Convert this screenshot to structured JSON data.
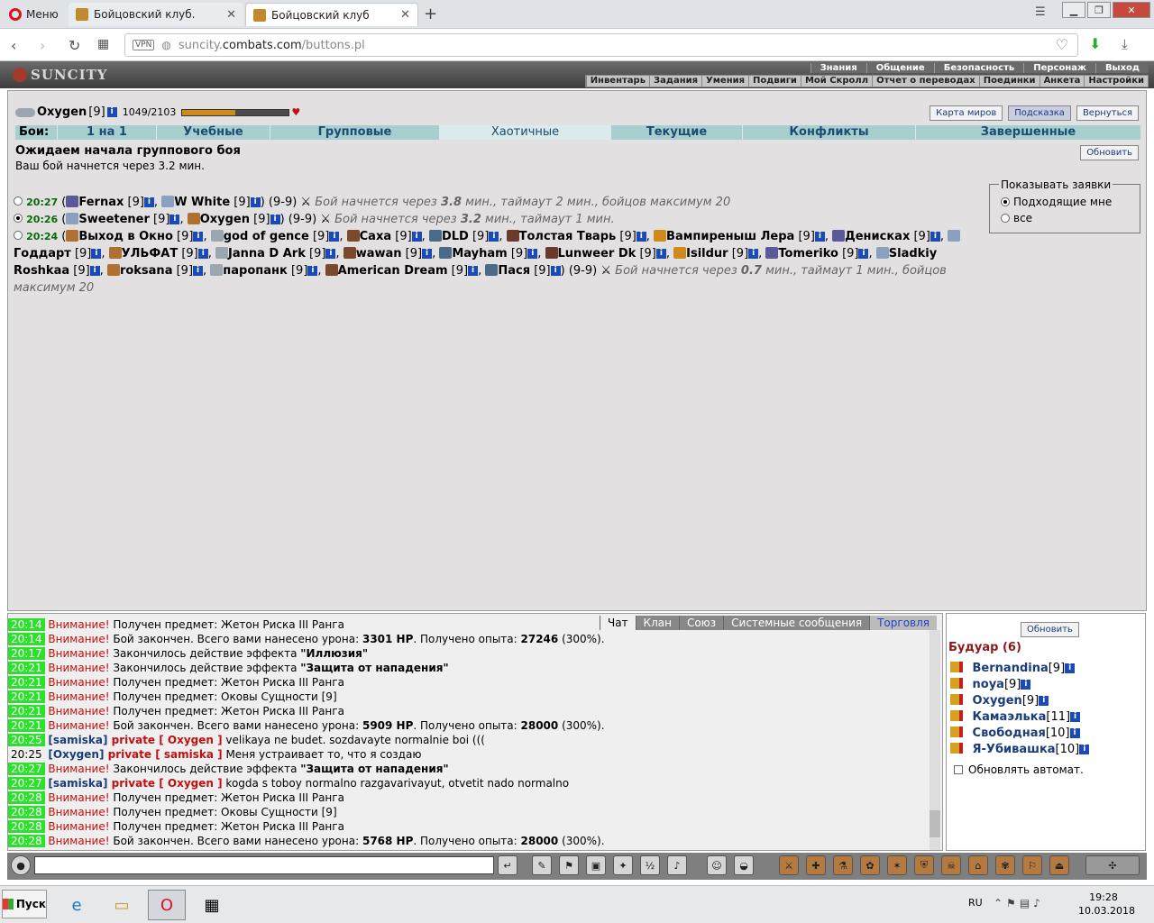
{
  "browser": {
    "menu_label": "Меню",
    "tabs": [
      {
        "title": "Бойцовский клуб."
      },
      {
        "title": "Бойцовский клуб"
      }
    ],
    "vpn": "VPN",
    "url_prefix": "suncity.",
    "url_domain": "combats.com",
    "url_path": "/buttons.pl"
  },
  "site": {
    "logo": "SUNCITY",
    "top_menu": [
      "Знания",
      "Общение",
      "Безопасность",
      "Персонаж",
      "Выход"
    ],
    "sub_menu": [
      "Инвентарь",
      "Задания",
      "Умения",
      "Подвиги",
      "Мой Скролл",
      "Отчет о переводах",
      "Поединки",
      "Анкета",
      "Настройки"
    ]
  },
  "player": {
    "name": "Oxygen",
    "level": "[9]",
    "hp": "1049/2103",
    "hp_fraction": 0.4988
  },
  "top_buttons": [
    "Карта миров",
    "Подсказка",
    "Вернуться"
  ],
  "battle_tabs": {
    "label": "Бои:",
    "tabs": [
      "1 на 1",
      "Учебные",
      "Групповые",
      "Хаотичные",
      "Текущие",
      "Конфликты",
      "Завершенные"
    ],
    "active": "Хаотичные"
  },
  "status": {
    "title": "Ожидаем начала группового боя",
    "text": "Ваш бой начнется через 3.2 мин.",
    "refresh": "Обновить"
  },
  "show_filter": {
    "legend": "Показывать заявки",
    "options": [
      "Подходящие мне",
      "все"
    ],
    "selected": "Подходящие мне"
  },
  "bids": [
    {
      "time": "20:27",
      "players": [
        {
          "n": "Fernax",
          "l": "[9]"
        },
        {
          "n": "W White",
          "l": "[9]"
        }
      ],
      "range": "(9-9)",
      "note_pre": "Бой начнется через ",
      "mins": "3.8",
      "note_post": " мин., таймаут 2 мин., бойцов максимум 20"
    },
    {
      "time": "20:26",
      "players": [
        {
          "n": "Sweetener",
          "l": "[9]"
        },
        {
          "n": "Oxygen",
          "l": "[9]"
        }
      ],
      "range": "(9-9)",
      "note_pre": "Бой начнется через ",
      "mins": "3.2",
      "note_post": " мин., таймаут 1 мин."
    },
    {
      "time": "20:24",
      "players": [
        {
          "n": "Выход в Окно",
          "l": "[9]"
        },
        {
          "n": "god of gence",
          "l": "[9]"
        },
        {
          "n": "Саха",
          "l": "[9]"
        },
        {
          "n": "DLD",
          "l": "[9]"
        },
        {
          "n": "Толстая Тварь",
          "l": "[9]"
        },
        {
          "n": "Вампиреныш Лера",
          "l": "[9]"
        },
        {
          "n": "Денисках",
          "l": "[9]"
        },
        {
          "n": "Годдарт",
          "l": "[9]"
        },
        {
          "n": "УЛЬФАТ",
          "l": "[9]"
        },
        {
          "n": "Janna D Ark",
          "l": "[9]"
        },
        {
          "n": "wawan",
          "l": "[9]"
        },
        {
          "n": "Mayham",
          "l": "[9]"
        },
        {
          "n": "Lunweer Dk",
          "l": "[9]"
        },
        {
          "n": "Isildur",
          "l": "[9]"
        },
        {
          "n": "Tomeriko",
          "l": "[9]"
        },
        {
          "n": "Sladkiy Roshkaa",
          "l": "[9]"
        },
        {
          "n": "roksana",
          "l": "[9]"
        },
        {
          "n": "паропанк",
          "l": "[9]"
        },
        {
          "n": "American Dream",
          "l": "[9]"
        },
        {
          "n": "Пася",
          "l": "[9]"
        }
      ],
      "range": "(9-9)",
      "note_pre": "Бой начнется через ",
      "mins": "0.7",
      "note_post": " мин., таймаут 1 мин., бойцов максимум 20"
    }
  ],
  "chat": {
    "tabs": [
      "Чат",
      "Клан",
      "Союз",
      "Системные сообщения",
      "Торговля"
    ],
    "lines": [
      {
        "t": "20:14",
        "a": "Внимание!",
        "m": " Получен предмет: Жетон Риска III Ранга"
      },
      {
        "t": "20:14",
        "a": "Внимание!",
        "m": " Бой закончен. Всего вами нанесено урона: ",
        "b1": "3301 HP",
        "m2": ". Получено опыта: ",
        "b2": "27246",
        "m3": " (300%)."
      },
      {
        "t": "20:17",
        "a": "Внимание!",
        "m": " Закончилось действие эффекта ",
        "b1": "\"Иллюзия\""
      },
      {
        "t": "20:21",
        "a": "Внимание!",
        "m": " Закончилось действие эффекта ",
        "b1": "\"Защита от нападения\""
      },
      {
        "t": "20:21",
        "a": "Внимание!",
        "m": " Получен предмет: Жетон Риска III Ранга"
      },
      {
        "t": "20:21",
        "a": "Внимание!",
        "m": " Получен предмет: Оковы Сущности [9]"
      },
      {
        "t": "20:21",
        "a": "Внимание!",
        "m": " Получен предмет: Жетон Риска III Ранга"
      },
      {
        "t": "20:21",
        "a": "Внимание!",
        "m": " Бой закончен. Всего вами нанесено урона: ",
        "b1": "5909 HP",
        "m2": ". Получено опыта: ",
        "b2": "28000",
        "m3": " (300%)."
      },
      {
        "t": "20:25",
        "nick": "[samiska]",
        "priv": " private [ Oxygen ]",
        "m": " velikaya ne budet. sozdavayte normalnie boi ((("
      },
      {
        "t": "20:25",
        "nb": true,
        "nick": "[Oxygen]",
        "priv": " private [ samiska ]",
        "m": " Меня устраивает то, что я создаю"
      },
      {
        "t": "20:27",
        "a": "Внимание!",
        "m": " Закончилось действие эффекта ",
        "b1": "\"Защита от нападения\""
      },
      {
        "t": "20:27",
        "nick": "[samiska]",
        "priv": " private [ Oxygen ]",
        "m": " kogda s toboy normalno razgavarivayut, otvetit nado normalno"
      },
      {
        "t": "20:28",
        "a": "Внимание!",
        "m": " Получен предмет: Жетон Риска III Ранга"
      },
      {
        "t": "20:28",
        "a": "Внимание!",
        "m": " Получен предмет: Оковы Сущности [9]"
      },
      {
        "t": "20:28",
        "a": "Внимание!",
        "m": " Получен предмет: Жетон Риска III Ранга"
      },
      {
        "t": "20:28",
        "a": "Внимание!",
        "m": " Бой закончен. Всего вами нанесено урона: ",
        "b1": "5768 HP",
        "m2": ". Получено опыта: ",
        "b2": "28000",
        "m3": " (300%)."
      }
    ]
  },
  "room": {
    "refresh": "Обновить",
    "title": "Будуар (6)",
    "users": [
      {
        "n": "Bernandina",
        "l": "[9]"
      },
      {
        "n": "noya",
        "l": "[9]"
      },
      {
        "n": "Oxygen",
        "l": "[9]"
      },
      {
        "n": "Камаэлька",
        "l": "[11]"
      },
      {
        "n": "Свободная",
        "l": "[10]"
      },
      {
        "n": "Я-Убивашка",
        "l": "[10]"
      }
    ],
    "auto": "Обновлять автомат."
  },
  "taskbar": {
    "start": "Пуск",
    "lang": "RU",
    "time": "19:28",
    "date": "10.03.2018"
  }
}
